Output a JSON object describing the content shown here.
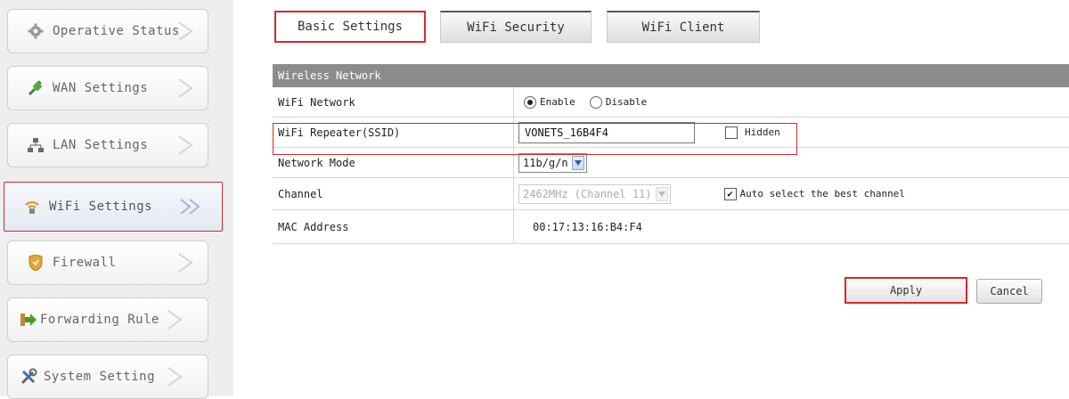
{
  "sidebar": {
    "items": [
      {
        "label": "Operative Status",
        "icon": "gear-icon"
      },
      {
        "label": "WAN Settings",
        "icon": "plug-icon"
      },
      {
        "label": "LAN Settings",
        "icon": "network-icon"
      },
      {
        "label": "WiFi Settings",
        "icon": "wifi-icon"
      },
      {
        "label": "Firewall",
        "icon": "shield-icon"
      },
      {
        "label": "Forwarding Rule",
        "icon": "forward-arrow-icon"
      },
      {
        "label": "System Setting",
        "icon": "tools-icon"
      }
    ],
    "active_index": 3
  },
  "tabs": [
    {
      "label": "Basic Settings",
      "active": true
    },
    {
      "label": "WiFi Security",
      "active": false
    },
    {
      "label": "WiFi Client",
      "active": false
    }
  ],
  "panel": {
    "title": "Wireless Network",
    "wifi_network": {
      "label": "WiFi Network",
      "enable_label": "Enable",
      "disable_label": "Disable",
      "selected": "Enable"
    },
    "ssid": {
      "label": "WiFi Repeater(SSID)",
      "value": "VONETS_16B4F4",
      "hidden_label": "Hidden",
      "hidden_checked": false
    },
    "network_mode": {
      "label": "Network Mode",
      "value": "11b/g/n"
    },
    "channel": {
      "label": "Channel",
      "value": "2462MHz (Channel 11)",
      "auto_label": "Auto select the best channel",
      "auto_checked": true
    },
    "mac": {
      "label": "MAC Address",
      "value": "00:17:13:16:B4:F4"
    }
  },
  "buttons": {
    "apply": "Apply",
    "cancel": "Cancel"
  },
  "colors": {
    "highlight": "#d42a2a",
    "panel_header": "#8c8c8c"
  }
}
